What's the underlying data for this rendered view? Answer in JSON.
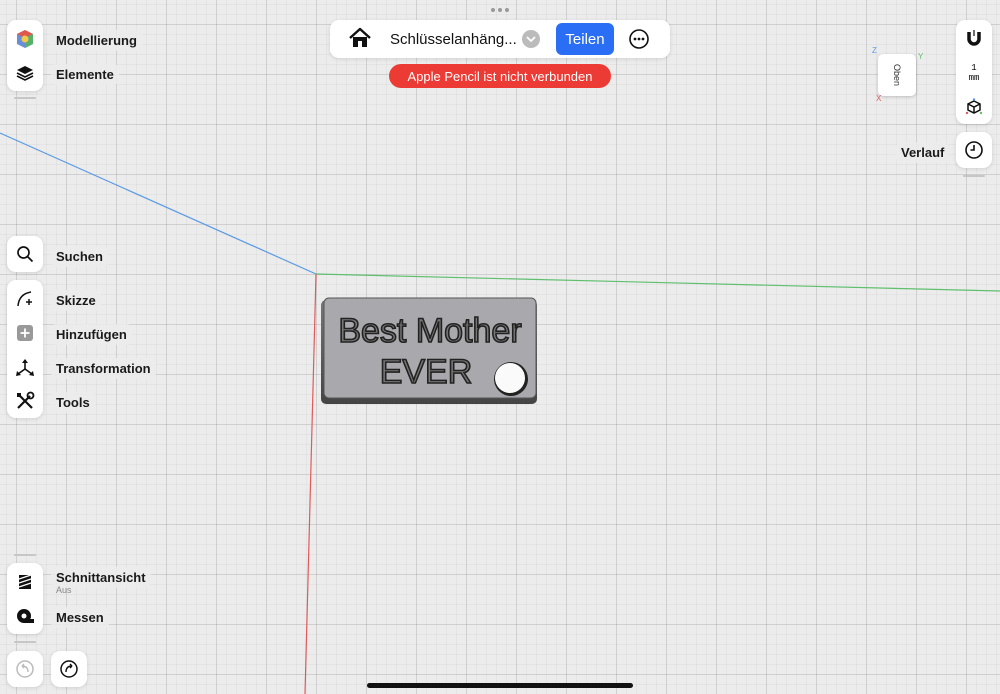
{
  "topbar": {
    "document_title": "Schlüsselanhäng...",
    "share_label": "Teilen"
  },
  "status": {
    "pencil_message": "Apple Pencil ist nicht verbunden"
  },
  "left_toolbar": {
    "top": [
      {
        "label": "Modellierung",
        "icon": "modeling-cube-icon"
      },
      {
        "label": "Elemente",
        "icon": "layers-icon"
      }
    ],
    "search": {
      "label": "Suchen",
      "icon": "search-icon"
    },
    "tools": [
      {
        "label": "Skizze",
        "icon": "sketch-icon"
      },
      {
        "label": "Hinzufügen",
        "icon": "add-icon"
      },
      {
        "label": "Transformation",
        "icon": "transform-icon"
      },
      {
        "label": "Tools",
        "icon": "tools-icon"
      }
    ],
    "bottom": [
      {
        "label": "Schnittansicht",
        "sublabel": "Aus",
        "icon": "section-view-icon"
      },
      {
        "label": "Messen",
        "icon": "measure-tape-icon"
      }
    ],
    "undo_icon": "undo-icon",
    "redo_icon": "redo-icon"
  },
  "right_toolbar": {
    "snap_icon": "magnet-icon",
    "unit_value": "1",
    "unit_label": "mm",
    "view_icon": "view-cube-icon",
    "history_label": "Verlauf",
    "history_icon": "clock-icon"
  },
  "viewcube": {
    "face_label": "Oben",
    "axis_x": "X",
    "axis_y": "Y",
    "axis_z": "Z"
  },
  "model": {
    "text_line1": "Best Mother",
    "text_line2": "EVER"
  },
  "colors": {
    "accent": "#2b6ef6",
    "warning": "#ec3b35",
    "axis_x": "#e05a5a",
    "axis_y": "#5fbf6f",
    "axis_z": "#5a9ae6"
  }
}
